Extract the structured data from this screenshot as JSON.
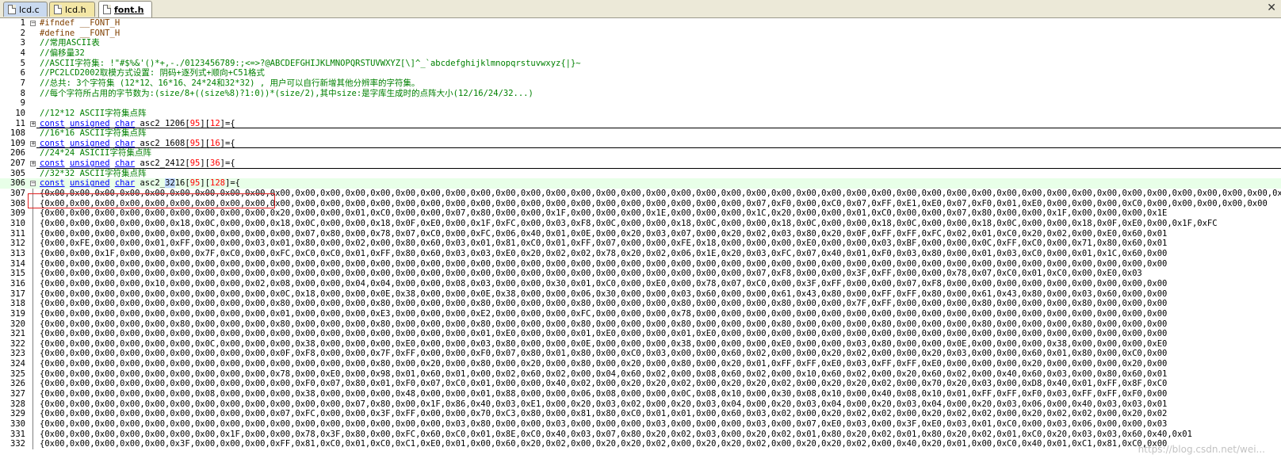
{
  "tabs": [
    {
      "label": "lcd.c"
    },
    {
      "label": "lcd.h"
    },
    {
      "label": "font.h",
      "active": true
    }
  ],
  "editor": {
    "lines": [
      {
        "n": "1",
        "text": "#ifndef __FONT_H",
        "kind": "pp",
        "fold": "minus"
      },
      {
        "n": "2",
        "text": "#define __FONT_H",
        "kind": "pp"
      },
      {
        "n": "3",
        "text": "//常用ASCII表",
        "kind": "cm"
      },
      {
        "n": "4",
        "text": "//偏移量32",
        "kind": "cm"
      },
      {
        "n": "5",
        "text": "//ASCII字符集: !\"#$%&'()*+,-./0123456789:;<=>?@ABCDEFGHIJKLMNOPQRSTUVWXYZ[\\]^_`abcdefghijklmnopqrstuvwxyz{|}~",
        "kind": "cm"
      },
      {
        "n": "6",
        "text": "//PC2LCD2002取模方式设置: 阴码+逐列式+顺向+C51格式",
        "kind": "cm"
      },
      {
        "n": "7",
        "text": "//总共: 3个字符集 (12*12、16*16、24*24和32*32) , 用户可以自行新增其他分辨率的字符集。",
        "kind": "cm"
      },
      {
        "n": "8",
        "text": "//每个字符所占用的字节数为:(size/8+((size%8)?1:0))*(size/2),其中size:是字库生成时的点阵大小(12/16/24/32...)",
        "kind": "cm"
      },
      {
        "n": "9",
        "text": "",
        "kind": "blank"
      },
      {
        "n": "10",
        "text": "//12*12 ASCII字符集点阵",
        "kind": "cm"
      },
      {
        "n": "11",
        "text": "const unsigned char asc2_1206[95][12]={",
        "kind": "decl",
        "fold": "plus",
        "sep": true
      },
      {
        "n": "108",
        "text": "//16*16 ASCII字符集点阵",
        "kind": "cm"
      },
      {
        "n": "109",
        "text": "const unsigned char asc2_1608[95][16]={",
        "kind": "decl",
        "fold": "plus",
        "sep": true
      },
      {
        "n": "206",
        "text": "//24*24 ASICII字符集点阵",
        "kind": "cm"
      },
      {
        "n": "207",
        "text": "const unsigned char asc2_2412[95][36]={",
        "kind": "decl",
        "fold": "plus",
        "sep": true
      },
      {
        "n": "305",
        "text": "//32*32 ASCII字符集点阵",
        "kind": "cm"
      },
      {
        "n": "306",
        "text": "const unsigned char asc2_3216[95][128]={",
        "kind": "decl",
        "fold": "minus",
        "hl": true
      },
      {
        "n": "307",
        "text": "{0x00,0x00,0x00,0x00,0x00,0x00,0x00,0x00,0x00,0x00,0x00,0x00,0x00,0x00,0x00,0x00,0x00,0x00,0x00,0x00,0x00,0x00,0x00,0x00,0x00,0x00,0x00,0x00,0x00,0x00,0x00,0x00,0x00,0x00,0x00,0x00,0x00,0x00,0x00,0x00,0x00,0x00,0x00,0x00,0x00,0x00,0x00,0x00,0x00,0x00,0x00",
        "kind": "hex"
      },
      {
        "n": "308",
        "text": "{0x00,0x00,0x00,0x00,0x00,0x00,0x00,0x00,0x00,0x00,0x00,0x00,0x00,0x00,0x00,0x00,0x00,0x00,0x00,0x00,0x00,0x00,0x00,0x00,0x00,0x00,0x00,0x00,0x07,0xF0,0x00,0xC0,0x07,0xFF,0xE1,0xE0,0x07,0xF0,0x01,0xE0,0x00,0x00,0x00,0xC0,0x00,0x00,0x00,0x00,0x00",
        "kind": "hex"
      },
      {
        "n": "309",
        "text": "{0x00,0x00,0x00,0x00,0x00,0x00,0x00,0x00,0x00,0x20,0x00,0x00,0x01,0xC0,0x00,0x00,0x07,0x80,0x00,0x00,0x1F,0x00,0x00,0x00,0x1E,0x00,0x00,0x00,0x1C,0x20,0x00,0x00,0x01,0xC0,0x00,0x00,0x07,0x80,0x00,0x00,0x1F,0x00,0x00,0x00,0x1E",
        "kind": "hex"
      },
      {
        "n": "310",
        "text": "{0x00,0x00,0x00,0x00,0x00,0x18,0x0C,0x00,0x00,0x18,0x0C,0x00,0x00,0x18,0x0F,0xE0,0x00,0x1F,0xFC,0x00,0x03,0xF8,0x0C,0x00,0x00,0x18,0x0C,0x00,0x00,0x18,0x0C,0x00,0x00,0x18,0x0C,0x00,0x00,0x18,0x0C,0x00,0x00,0x18,0x0F,0xE0,0x00,0x1F,0xFC",
        "kind": "hex"
      },
      {
        "n": "311",
        "text": "{0x00,0x00,0x00,0x00,0x00,0x00,0x00,0x00,0x00,0x00,0x07,0x80,0x00,0x78,0x07,0xC0,0x00,0xFC,0x06,0x40,0x01,0x0E,0x00,0x20,0x03,0x07,0x00,0x20,0x02,0x03,0x80,0x20,0x0F,0xFF,0xFF,0xFC,0x02,0x01,0xC0,0x20,0x02,0x00,0xE0,0x60,0x01",
        "kind": "hex"
      },
      {
        "n": "312",
        "text": "{0x00,0xFE,0x00,0x00,0x01,0xFF,0x00,0x00,0x03,0x01,0x80,0x00,0x02,0x00,0x80,0x60,0x03,0x01,0x81,0xC0,0x01,0xFF,0x07,0x00,0x00,0xFE,0x18,0x00,0x00,0x00,0xE0,0x00,0x00,0x03,0xBF,0x00,0x00,0x0C,0xFF,0xC0,0x00,0x71,0x80,0x60,0x01",
        "kind": "hex"
      },
      {
        "n": "313",
        "text": "{0x00,0x00,0x1F,0x00,0x00,0x00,0x7F,0xC0,0x00,0xFC,0xC0,0xC0,0x01,0xFF,0x80,0x60,0x03,0x03,0xE0,0x20,0x02,0x02,0x78,0x20,0x02,0x06,0x1E,0x20,0x03,0xFC,0x07,0x40,0x01,0xF0,0x03,0x80,0x00,0x01,0x03,0xC0,0x00,0x01,0x1C,0x60,0x00",
        "kind": "hex"
      },
      {
        "n": "314",
        "text": "{0x00,0x00,0x00,0x00,0x00,0x00,0x00,0x00,0x00,0x00,0x00,0x00,0x00,0x00,0x00,0x00,0x00,0x00,0x00,0x00,0x00,0x00,0x00,0x00,0x00,0x00,0x00,0x00,0x00,0x00,0x00,0x00,0x00,0x00,0x00,0x00,0x00,0x00,0x00,0x00,0x00,0x00,0x00,0x00,0x00",
        "kind": "hex"
      },
      {
        "n": "315",
        "text": "{0x00,0x00,0x00,0x00,0x00,0x00,0x00,0x00,0x00,0x00,0x00,0x00,0x00,0x00,0x00,0x00,0x00,0x00,0x00,0x00,0x00,0x00,0x00,0x00,0x00,0x00,0x00,0x00,0x07,0xF8,0x00,0x00,0x3F,0xFF,0x00,0x00,0x78,0x07,0xC0,0x01,0xC0,0x00,0xE0,0x03",
        "kind": "hex"
      },
      {
        "n": "316",
        "text": "{0x00,0x00,0x00,0x00,0x10,0x00,0x00,0x00,0x02,0x08,0x00,0x00,0x04,0x04,0x00,0x00,0x08,0x03,0x00,0x00,0x30,0x01,0xC0,0x00,0xE0,0x00,0x78,0x07,0xC0,0x00,0x3F,0xFF,0x00,0x00,0x07,0xF8,0x00,0x00,0x00,0x00,0x00,0x00,0x00,0x00,0x00",
        "kind": "hex"
      },
      {
        "n": "317",
        "text": "{0x00,0x00,0x00,0x00,0x00,0x00,0x00,0x00,0x00,0x0C,0x18,0x00,0x00,0x0E,0x38,0x00,0x00,0x0E,0x38,0x00,0x00,0x06,0x30,0x00,0x00,0x03,0x60,0x00,0x00,0x61,0x43,0x80,0x00,0xFF,0xFF,0x80,0x00,0x61,0x43,0x80,0x00,0x03,0x60,0x00,0x00",
        "kind": "hex"
      },
      {
        "n": "318",
        "text": "{0x00,0x00,0x00,0x00,0x00,0x00,0x00,0x00,0x00,0x80,0x00,0x00,0x00,0x80,0x00,0x00,0x00,0x80,0x00,0x00,0x00,0x80,0x00,0x00,0x00,0x80,0x00,0x00,0x00,0x80,0x00,0x00,0x7F,0xFF,0x00,0x00,0x00,0x80,0x00,0x00,0x00,0x80,0x00,0x00,0x00",
        "kind": "hex"
      },
      {
        "n": "319",
        "text": "{0x00,0x00,0x00,0x00,0x00,0x00,0x00,0x00,0x00,0x01,0x00,0x00,0x00,0xE3,0x00,0x00,0x00,0xE2,0x00,0x00,0x00,0xFC,0x00,0x00,0x00,0x78,0x00,0x00,0x00,0x00,0x00,0x00,0x00,0x00,0x00,0x00,0x00,0x00,0x00,0x00,0x00,0x00,0x00,0x00,0x00",
        "kind": "hex"
      },
      {
        "n": "320",
        "text": "{0x00,0x00,0x00,0x00,0x00,0x80,0x00,0x00,0x00,0x80,0x00,0x00,0x00,0x80,0x00,0x00,0x00,0x80,0x00,0x00,0x00,0x80,0x00,0x00,0x00,0x80,0x00,0x00,0x00,0x80,0x00,0x00,0x00,0x80,0x00,0x00,0x00,0x80,0x00,0x00,0x00,0x80,0x00,0x00,0x00",
        "kind": "hex"
      },
      {
        "n": "321",
        "text": "{0x00,0x00,0x00,0x00,0x00,0x00,0x00,0x00,0x00,0x00,0x00,0x00,0x00,0x00,0x00,0x00,0x00,0x01,0xE0,0x00,0x00,0x01,0xE0,0x00,0x00,0x01,0xE0,0x00,0x00,0x00,0x00,0x00,0x00,0x00,0x00,0x00,0x00,0x00,0x00,0x00,0x00,0x00,0x00,0x00,0x00",
        "kind": "hex"
      },
      {
        "n": "322",
        "text": "{0x00,0x00,0x00,0x00,0x00,0x00,0x0C,0x00,0x00,0x00,0x38,0x00,0x00,0x00,0xE0,0x00,0x00,0x03,0x80,0x00,0x00,0x0E,0x00,0x00,0x00,0x38,0x00,0x00,0x00,0xE0,0x00,0x00,0x03,0x80,0x00,0x00,0x0E,0x00,0x00,0x00,0x38,0x00,0x00,0x00,0xE0",
        "kind": "hex"
      },
      {
        "n": "323",
        "text": "{0x00,0x00,0x00,0x00,0x00,0x00,0x00,0x00,0x00,0x0F,0xF8,0x00,0x00,0x7F,0xFF,0x00,0x00,0xF0,0x07,0x80,0x01,0x80,0x00,0xC0,0x03,0x00,0x00,0x60,0x02,0x00,0x00,0x20,0x02,0x00,0x00,0x20,0x03,0x00,0x00,0x60,0x01,0x80,0x00,0xC0,0x00",
        "kind": "hex"
      },
      {
        "n": "324",
        "text": "{0x00,0x00,0x00,0x00,0x00,0x00,0x00,0x00,0x00,0x00,0x00,0x00,0x00,0x80,0x00,0x20,0x00,0x80,0x00,0x20,0x00,0x80,0x00,0x20,0x00,0x80,0x00,0x20,0x01,0xFF,0xFF,0xE0,0x03,0xFF,0xFF,0xE0,0x00,0x00,0x00,0x20,0x00,0x00,0x00,0x20,0x00",
        "kind": "hex"
      },
      {
        "n": "325",
        "text": "{0x00,0x00,0x00,0x00,0x00,0x00,0x00,0x00,0x00,0x78,0x00,0xE0,0x00,0x98,0x01,0x60,0x01,0x00,0x02,0x60,0x02,0x00,0x04,0x60,0x02,0x00,0x08,0x60,0x02,0x00,0x10,0x60,0x02,0x00,0x20,0x60,0x02,0x00,0x40,0x60,0x03,0x00,0x80,0x60,0x01",
        "kind": "hex"
      },
      {
        "n": "326",
        "text": "{0x00,0x00,0x00,0x00,0x00,0x00,0x00,0x00,0x00,0x00,0xF0,0x07,0x80,0x01,0xF0,0x07,0xC0,0x01,0x00,0x00,0x40,0x02,0x00,0x20,0x20,0x02,0x00,0x20,0x20,0x02,0x00,0x20,0x20,0x02,0x00,0x70,0x20,0x03,0x00,0xD8,0x40,0x01,0xFF,0x8F,0xC0",
        "kind": "hex"
      },
      {
        "n": "327",
        "text": "{0x00,0x00,0x00,0x00,0x00,0x00,0x08,0x00,0x00,0x00,0x38,0x00,0x00,0x00,0x48,0x00,0x00,0x01,0x88,0x00,0x00,0x06,0x08,0x00,0x00,0x0C,0x08,0x10,0x00,0x30,0x08,0x10,0x00,0x40,0x08,0x10,0x01,0xFF,0xFF,0xF0,0x03,0xFF,0xFF,0xF0,0x00",
        "kind": "hex"
      },
      {
        "n": "328",
        "text": "{0x00,0x00,0x00,0x00,0x00,0x00,0x00,0x00,0x00,0x00,0x00,0x00,0x07,0x80,0x00,0x1F,0x86,0x40,0x03,0xE1,0x00,0x20,0x03,0x02,0x00,0x20,0x03,0x04,0x00,0x20,0x03,0x04,0x00,0x20,0x03,0x04,0x00,0x20,0x03,0x06,0x00,0x40,0x03,0x03,0x01",
        "kind": "hex"
      },
      {
        "n": "329",
        "text": "{0x00,0x00,0x00,0x00,0x00,0x00,0x00,0x00,0x00,0x07,0xFC,0x00,0x00,0x3F,0xFF,0x00,0x00,0x70,0xC3,0x80,0x00,0x81,0x80,0xC0,0x01,0x01,0x00,0x60,0x03,0x02,0x00,0x20,0x02,0x02,0x00,0x20,0x02,0x02,0x00,0x20,0x02,0x02,0x00,0x20,0x02",
        "kind": "hex"
      },
      {
        "n": "330",
        "text": "{0x00,0x00,0x00,0x00,0x00,0x00,0x00,0x00,0x00,0x00,0x00,0x00,0x00,0x00,0x00,0x00,0x03,0x80,0x00,0x00,0x03,0x00,0x00,0x00,0x03,0x00,0x00,0x00,0x03,0x00,0x07,0xE0,0x03,0x00,0x3F,0xE0,0x03,0x01,0xC0,0x00,0x03,0x06,0x00,0x00,0x03",
        "kind": "hex"
      },
      {
        "n": "331",
        "text": "{0x00,0x00,0x00,0x00,0x00,0x00,0x00,0x1F,0x00,0x00,0x78,0x3F,0x80,0x00,0xFC,0x60,0xC0,0x01,0x8E,0xC0,0x40,0x03,0x07,0x80,0x20,0x02,0x03,0x00,0x20,0x02,0x01,0x80,0x20,0x02,0x01,0x80,0x20,0x02,0x01,0xC0,0x20,0x03,0x03,0x60,0x40,0x01",
        "kind": "hex"
      },
      {
        "n": "332",
        "text": "{0x00,0x00,0x00,0x00,0x00,0x3F,0x00,0x00,0x00,0xFF,0x81,0xC0,0x01,0xC0,0xC1,0xE0,0x01,0x00,0x60,0x20,0x02,0x00,0x20,0x20,0x02,0x00,0x20,0x20,0x02,0x00,0x20,0x20,0x02,0x00,0x40,0x20,0x01,0x00,0xC0,0x40,0x01,0xC1,0x81,0xC0,0x00",
        "kind": "hex"
      }
    ]
  },
  "watermark": "https://blog.csdn.net/wei...",
  "colors": {
    "comment": "#008000",
    "keyword": "#0000ff",
    "number": "#ff0000",
    "preprocessor": "#804000",
    "highlight_box": "#e02020"
  }
}
